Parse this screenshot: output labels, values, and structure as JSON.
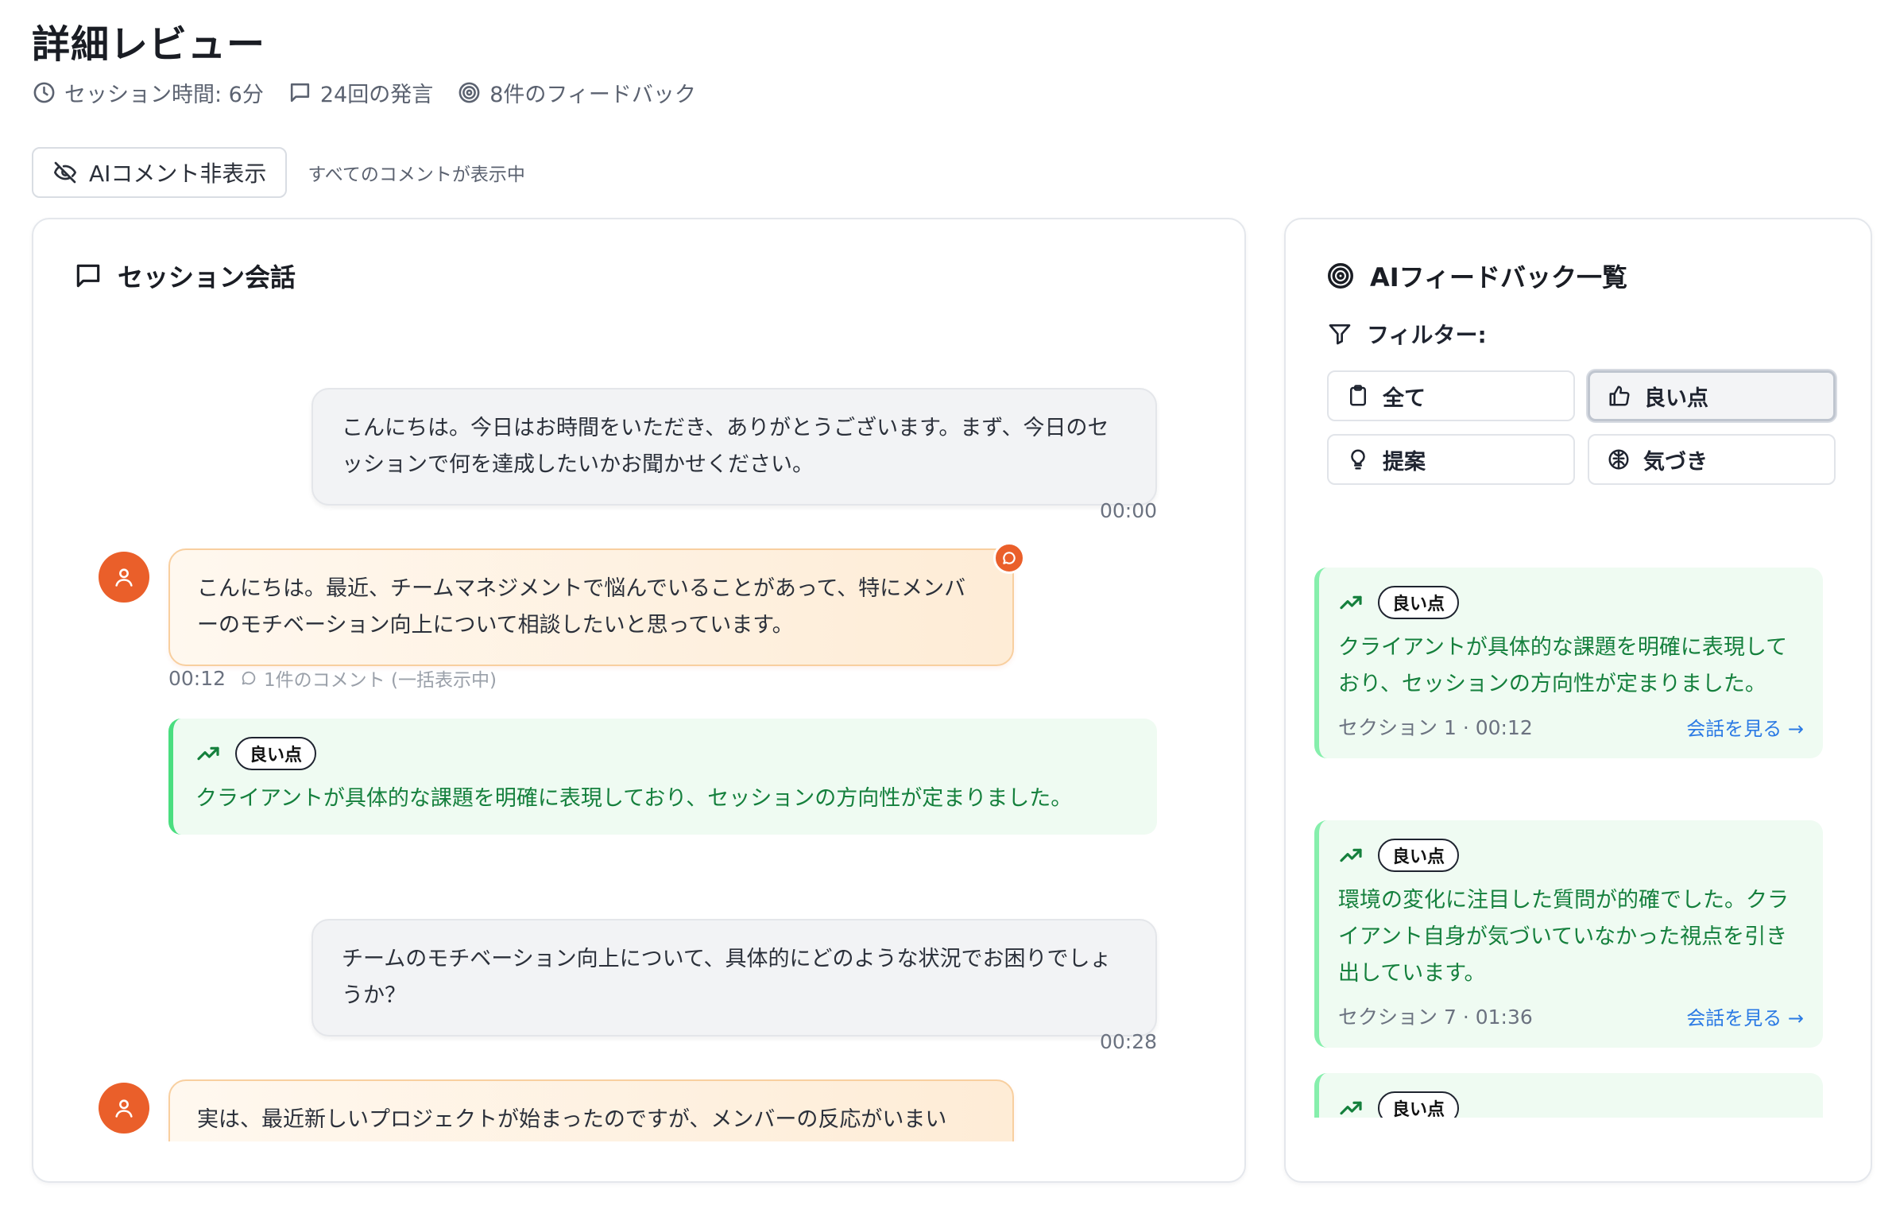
{
  "header": {
    "title": "詳細レビュー",
    "session_time": "セッション時間: 6分",
    "utterances": "24回の発言",
    "feedback_count": "8件のフィードバック"
  },
  "toggle": {
    "label": "AIコメント非表示",
    "status": "すべてのコメントが表示中"
  },
  "conversation": {
    "title": "セッション会話",
    "messages": [
      {
        "role": "coach",
        "text": "こんにちは。今日はお時間をいただき、ありがとうございます。まず、今日のセッションで何を達成したいかお聞かせください。",
        "time": "00:00"
      },
      {
        "role": "client",
        "text": "こんにちは。最近、チームマネジメントで悩んでいることがあって、特にメンバーのモチベーション向上について相談したいと思っています。",
        "time": "00:12",
        "comment_info": "1件のコメント (一括表示中)",
        "feedback": {
          "tag": "良い点",
          "text": "クライアントが具体的な課題を明確に表現しており、セッションの方向性が定まりました。"
        }
      },
      {
        "role": "coach",
        "text": "チームのモチベーション向上について、具体的にどのような状況でお困りでしょうか？",
        "time": "00:28"
      },
      {
        "role": "client",
        "text": "実は、最近新しいプロジェクトが始まったのですが、メンバーの反応がいまい"
      }
    ]
  },
  "feedback_panel": {
    "title": "AIフィードバック一覧",
    "filter_label": "フィルター:",
    "filters": [
      {
        "label": "全て",
        "icon": "clipboard-icon",
        "active": false
      },
      {
        "label": "良い点",
        "icon": "thumbs-up-icon",
        "active": true
      },
      {
        "label": "提案",
        "icon": "lightbulb-icon",
        "active": false
      },
      {
        "label": "気づき",
        "icon": "brain-icon",
        "active": false
      }
    ],
    "items": [
      {
        "tag": "良い点",
        "text": "クライアントが具体的な課題を明確に表現しており、セッションの方向性が定まりました。",
        "section": "セクション 1",
        "time": "00:12",
        "link": "会話を見る →"
      },
      {
        "tag": "良い点",
        "text": "環境の変化に注目した質問が的確でした。クライアント自身が気づいていなかった視点を引き出しています。",
        "section": "セクション 7",
        "time": "01:36",
        "link": "会話を見る →"
      },
      {
        "tag": "良い点"
      }
    ]
  },
  "colors": {
    "accent_orange": "#ea5f2a",
    "positive_green": "#15803d",
    "link_blue": "#2b7ae4"
  }
}
